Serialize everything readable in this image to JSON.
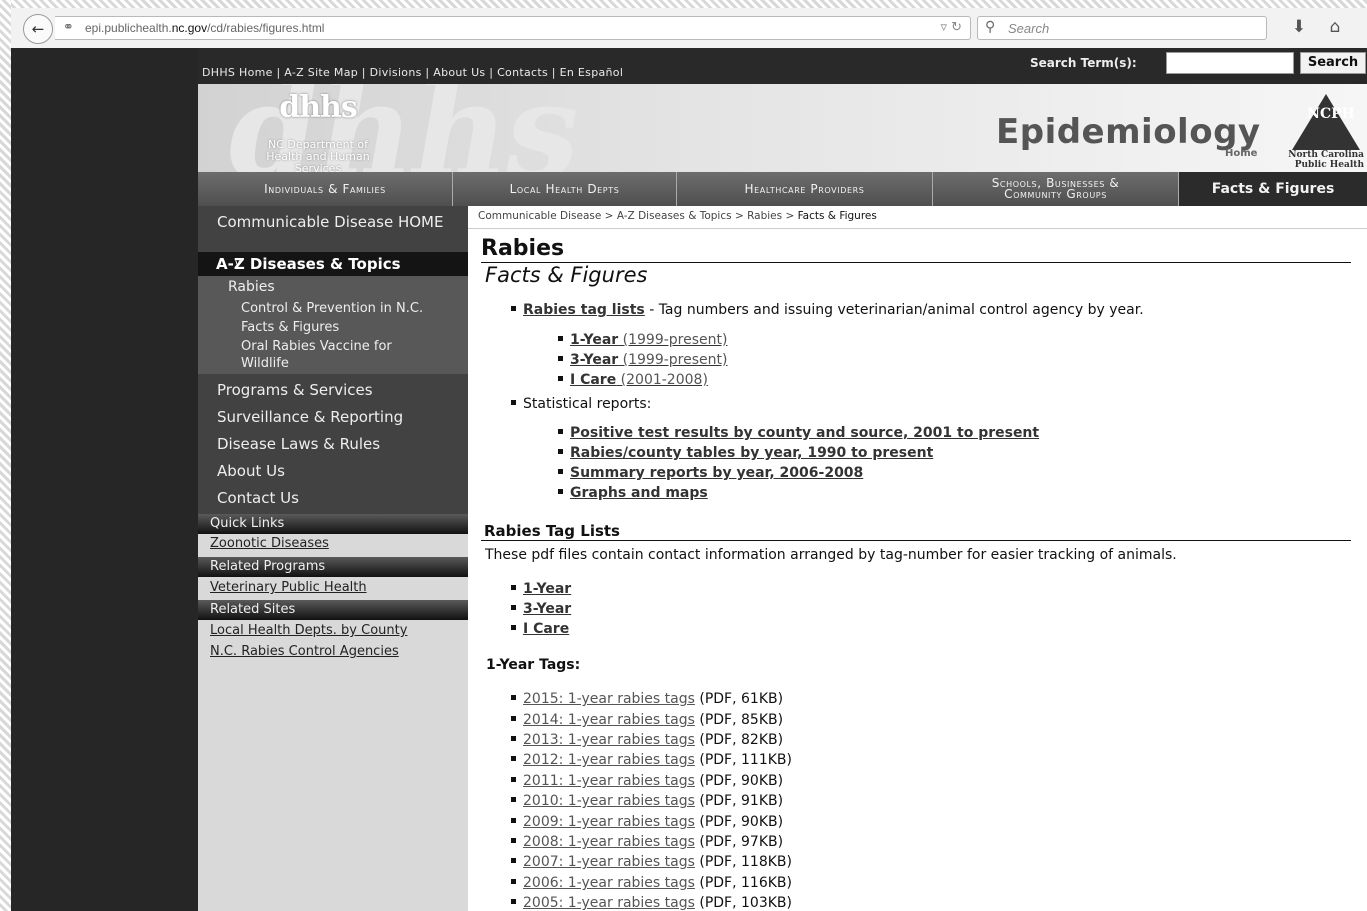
{
  "browser": {
    "url_prefix": "epi.publichealth.",
    "url_domain": "nc.gov",
    "url_path": "/cd/rabies/figures.html",
    "search_placeholder": "Search"
  },
  "util_nav": {
    "items": [
      "DHHS Home",
      "A-Z Site Map",
      "Divisions",
      "About Us",
      "Contacts",
      "En Español"
    ],
    "search_label": "Search Term(s):",
    "search_button": "Search"
  },
  "banner": {
    "logo_mark": "dhhs",
    "dept_line1": "NC Department of",
    "dept_line2": "Health and Human Services",
    "site_title": "Epidemiology",
    "home_label": "Home",
    "ncph_logo": "NCPH",
    "ncph_line1": "North Carolina",
    "ncph_line2": "Public Health"
  },
  "main_nav": [
    {
      "label": "Individuals & Families"
    },
    {
      "label": "Local Health Depts"
    },
    {
      "label": "Healthcare Providers"
    },
    {
      "label": "Schools, Businesses & Community Groups"
    },
    {
      "label": "Facts & Figures"
    }
  ],
  "sidebar": {
    "home": "Communicable Disease HOME",
    "az_label": "A-Z Diseases & Topics",
    "rabies": "Rabies",
    "rabies_sub": [
      "Control & Prevention in N.C.",
      "Facts & Figures",
      "Oral Rabies Vaccine for Wildlife"
    ],
    "items": [
      "Programs & Services",
      "Surveillance & Reporting",
      "Disease Laws & Rules",
      "About Us",
      "Contact Us"
    ],
    "quick_links_hdr": "Quick Links",
    "quick_links": [
      "Zoonotic Diseases"
    ],
    "related_programs_hdr": "Related Programs",
    "related_programs": [
      "Veterinary Public Health"
    ],
    "related_sites_hdr": "Related Sites",
    "related_sites": [
      "Local Health Depts. by County",
      "N.C. Rabies Control Agencies"
    ]
  },
  "content": {
    "breadcrumb": [
      "Communicable Disease",
      "A-Z Diseases & Topics",
      "Rabies",
      "Facts & Figures"
    ],
    "title": "Rabies",
    "subtitle": "Facts & Figures",
    "tag_lists_link": "Rabies tag lists",
    "tag_lists_desc": " - Tag numbers and issuing veterinarian/animal control agency by year.",
    "tag_sub": [
      {
        "label": "1-Year",
        "range": " (1999-present)"
      },
      {
        "label": "3-Year",
        "range": " (1999-present)"
      },
      {
        "label": "I Care",
        "range": " (2001-2008)"
      }
    ],
    "stat_label": "Statistical reports:",
    "stat_links": [
      "Positive test results by county and source, 2001 to present",
      "Rabies/county tables by year, 1990 to present",
      "Summary reports by year, 2006-2008",
      "Graphs and maps"
    ],
    "section_title": "Rabies Tag Lists",
    "section_desc": "These pdf files contain contact information arranged by tag-number for easier tracking of animals.",
    "section_links": [
      "1-Year",
      "3-Year",
      "I Care"
    ],
    "one_year_hdr": "1-Year Tags:",
    "one_year_files": [
      {
        "link": "2015: 1-year rabies tags",
        "info": " (PDF, 61KB)"
      },
      {
        "link": "2014: 1-year rabies tags",
        "info": " (PDF, 85KB)"
      },
      {
        "link": "2013: 1-year rabies tags",
        "info": " (PDF, 82KB)"
      },
      {
        "link": "2012: 1-year rabies tags",
        "info": " (PDF, 111KB)"
      },
      {
        "link": "2011: 1-year rabies tags",
        "info": " (PDF, 90KB)"
      },
      {
        "link": "2010: 1-year rabies tags",
        "info": " (PDF, 91KB)"
      },
      {
        "link": "2009: 1-year rabies tags",
        "info": " (PDF, 90KB)"
      },
      {
        "link": "2008: 1-year rabies tags",
        "info": " (PDF, 97KB)"
      },
      {
        "link": "2007: 1-year rabies tags",
        "info": " (PDF, 118KB)"
      },
      {
        "link": "2006: 1-year rabies tags",
        "info": " (PDF, 116KB)"
      },
      {
        "link": "2005: 1-year rabies tags",
        "info": " (PDF, 103KB)"
      }
    ]
  },
  "icons": {
    "back": "back-arrow-icon",
    "globe": "globe-icon",
    "reload": "reload-icon",
    "search": "search-icon",
    "download": "download-icon",
    "home": "home-icon"
  }
}
